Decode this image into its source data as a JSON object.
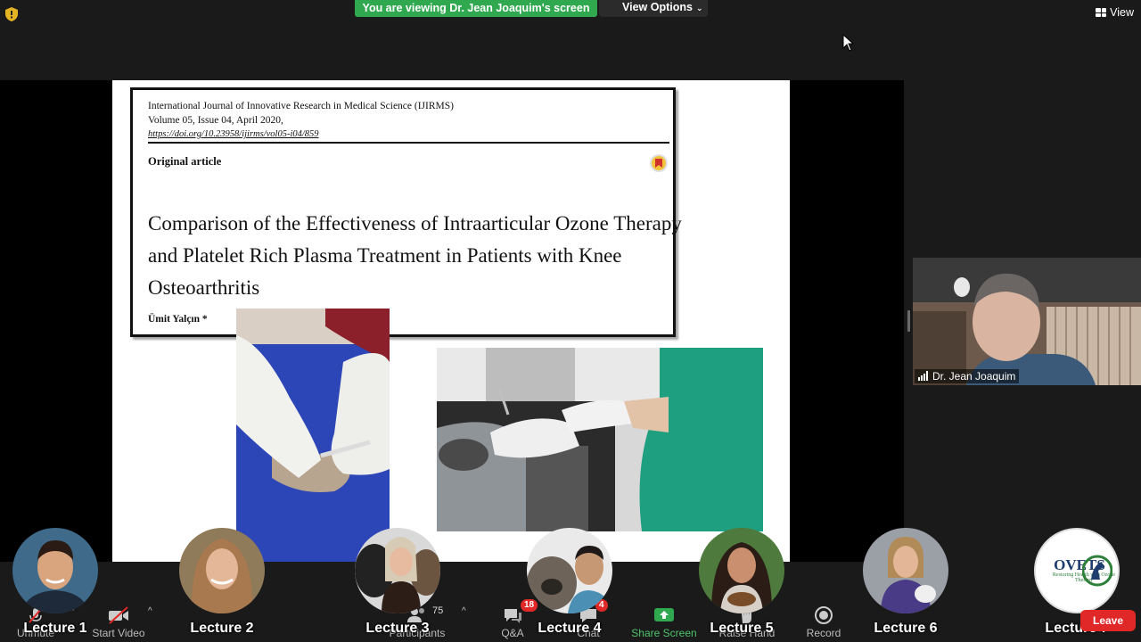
{
  "top_bar": {
    "viewing_banner": "You are viewing Dr. Jean Joaquim's screen",
    "view_options": "View Options",
    "view_label": "View"
  },
  "slide": {
    "journal_line1": "International Journal of Innovative Research in Medical Science (IJIRMS)",
    "journal_line2": "Volume 05, Issue 04, April 2020,",
    "doi": "https://doi.org/10.23958/ijirms/vol05-i04/859",
    "article_type": "Original article",
    "title": "Comparison of the Effectiveness of Intraarticular Ozone Therapy and Platelet Rich Plasma Treatment in Patients with Knee Osteoarthritis",
    "author": "Ümit Yalçın *"
  },
  "speaker": {
    "name": "Dr. Jean Joaquim"
  },
  "toolbar": {
    "unmute": "Unmute",
    "start_video": "Start Video",
    "participants": "Participants",
    "participants_count": "75",
    "qa": "Q&A",
    "qa_badge": "18",
    "chat": "Chat",
    "chat_badge": "4",
    "share_screen": "Share Screen",
    "raise_hand": "Raise Hand",
    "record": "Record",
    "leave": "Leave"
  },
  "lectures": [
    {
      "label": "Lecture 1"
    },
    {
      "label": "Lecture 2"
    },
    {
      "label": "Lecture 3"
    },
    {
      "label": "Lecture 4"
    },
    {
      "label": "Lecture 5"
    },
    {
      "label": "Lecture 6"
    },
    {
      "label": "Lecture 7",
      "logo_text": "OVETS",
      "logo_sub": "Restoring Health with Ozone Therapy"
    }
  ],
  "colors": {
    "banner_green": "#2fa84f",
    "leave_red": "#e02828",
    "share_green": "#2fa84f",
    "background": "#1a1a1a"
  }
}
